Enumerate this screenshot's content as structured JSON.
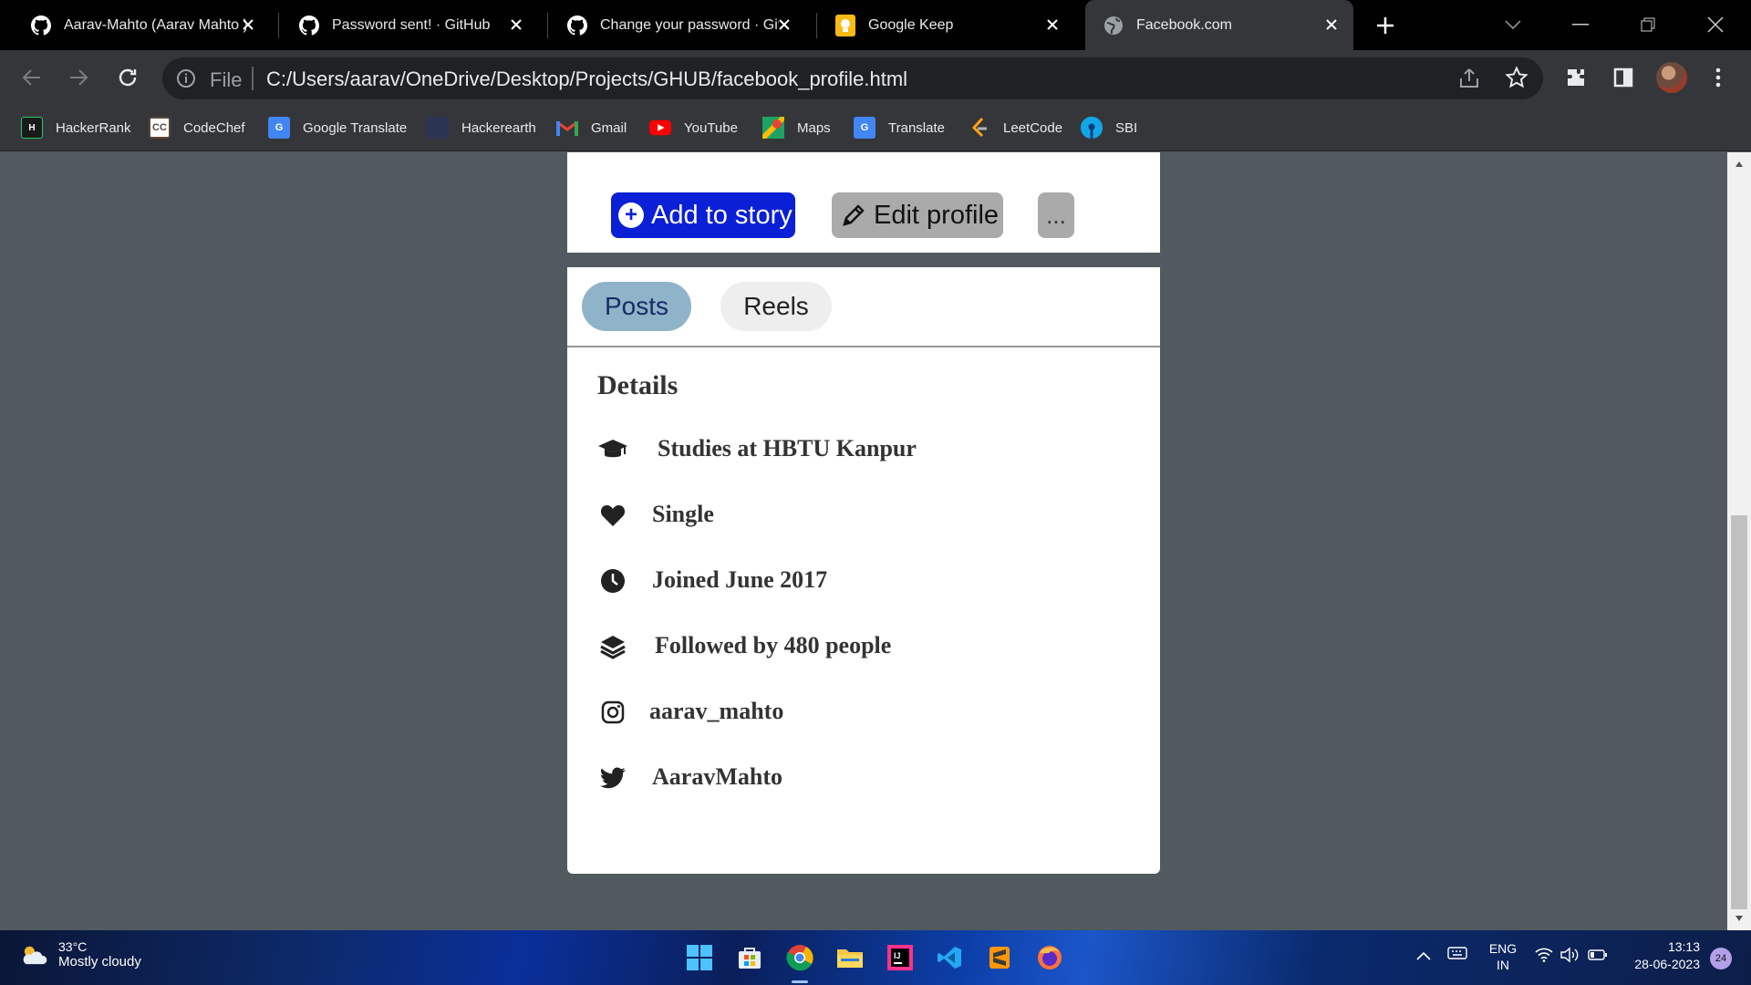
{
  "browser": {
    "tabs": [
      {
        "title": "Aarav-Mahto (Aarav Mahto )",
        "icon": "github-icon"
      },
      {
        "title": "Password sent! · GitHub",
        "icon": "github-icon"
      },
      {
        "title": "Change your password · GitHub",
        "icon": "github-icon"
      },
      {
        "title": "Google Keep",
        "icon": "keep-icon"
      },
      {
        "title": "Facebook.com",
        "icon": "globe-icon",
        "active": true
      }
    ],
    "address": {
      "scheme_label": "File",
      "url": "C:/Users/aarav/OneDrive/Desktop/Projects/GHUB/facebook_profile.html"
    },
    "bookmarks": [
      "HackerRank",
      "CodeChef",
      "Google Translate",
      "Hackerearth",
      "Gmail",
      "YouTube",
      "Maps",
      "Translate",
      "LeetCode",
      "SBI"
    ]
  },
  "profile": {
    "actions": {
      "add_story": "Add to story",
      "edit_profile": "Edit profile",
      "more": "..."
    },
    "tabs": {
      "posts": "Posts",
      "reels": "Reels"
    },
    "details": {
      "title": "Details",
      "items": [
        {
          "icon": "graduation-cap-icon",
          "text": "Studies at HBTU Kanpur"
        },
        {
          "icon": "heart-icon",
          "text": "Single"
        },
        {
          "icon": "clock-icon",
          "text": "Joined June 2017"
        },
        {
          "icon": "layers-icon",
          "text": "Followed by 480 people"
        },
        {
          "icon": "instagram-icon",
          "text": "aarav_mahto"
        },
        {
          "icon": "twitter-icon",
          "text": "AaravMahto"
        }
      ]
    }
  },
  "taskbar": {
    "weather": {
      "temp": "33°C",
      "condition": "Mostly cloudy"
    },
    "language": {
      "line1": "ENG",
      "line2": "IN"
    },
    "time": "13:13",
    "date": "28-06-2023",
    "notifications": "24"
  }
}
